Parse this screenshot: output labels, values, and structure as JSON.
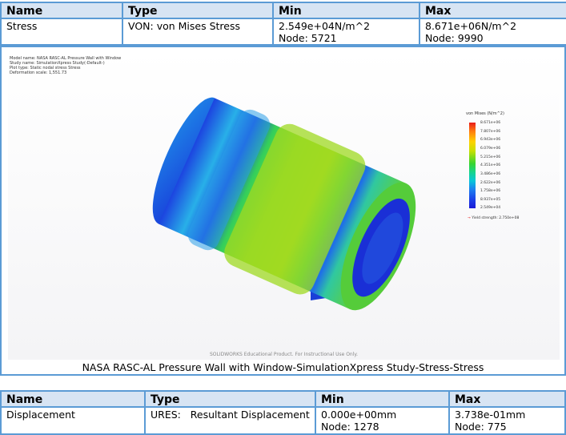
{
  "stress_table": {
    "headers": [
      "Name",
      "Type",
      "Min",
      "Max"
    ],
    "name": "Stress",
    "type": "VON: von Mises Stress",
    "min_value": "2.549e+04N/m^2",
    "min_node": "Node: 5721",
    "max_value": "8.671e+06N/m^2",
    "max_node": "Node: 9990"
  },
  "plot": {
    "model_info": [
      "Model name: NASA RASC-AL Pressure Wall with Window",
      "Study name: SimulationXpress Study(-Default-)",
      "Plot type: Static nodal stress Stress",
      "Deformation scale: 1,551.73"
    ],
    "legend_title": "von Mises (N/m^2)",
    "legend_ticks": [
      "8.671e+06",
      "7.807e+06",
      "6.943e+06",
      "6.079e+06",
      "5.215e+06",
      "4.351e+06",
      "3.486e+06",
      "2.622e+06",
      "1.758e+06",
      "8.937e+05",
      "2.549e+04"
    ],
    "yield_text": "Yield strength: 2.750e+08",
    "watermark": "SOLIDWORKS Educational Product. For Instructional Use Only.",
    "caption": "NASA RASC-AL Pressure Wall with Window-SimulationXpress Study-Stress-Stress"
  },
  "displacement_table": {
    "headers": [
      "Name",
      "Type",
      "Min",
      "Max"
    ],
    "name": "Displacement",
    "type": "URES:   Resultant Displacement",
    "min_value": "0.000e+00mm",
    "min_node": "Node: 1278",
    "max_value": "3.738e-01mm",
    "max_node": "Node: 775"
  },
  "colors": {
    "border": "#5b9bd5",
    "header_bg": "#d7e4f3"
  }
}
